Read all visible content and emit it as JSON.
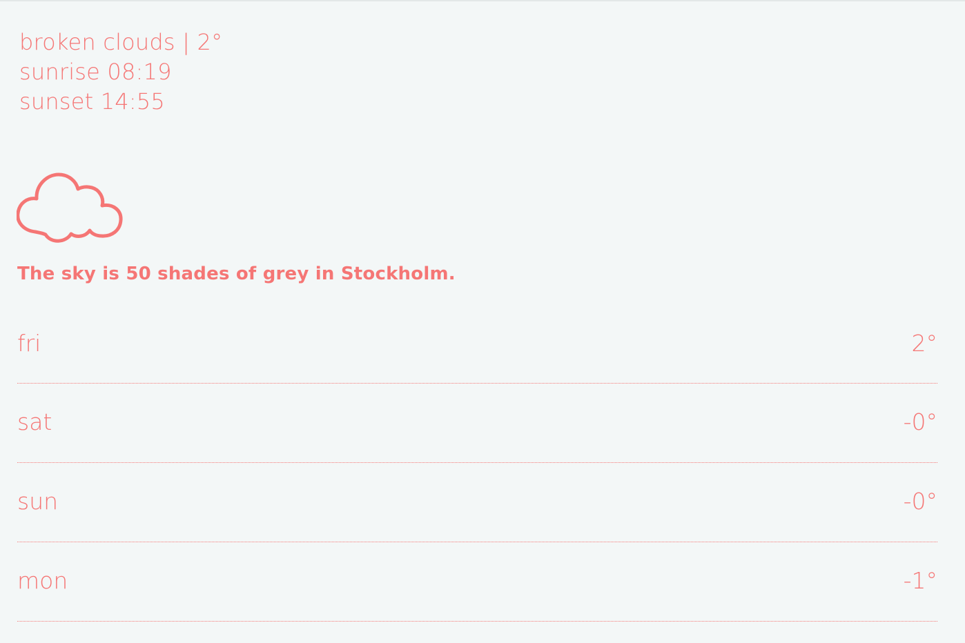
{
  "current": {
    "condition_line": "broken clouds | 2°",
    "sunrise_line": "sunrise 08:19",
    "sunset_line": "sunset 14:55"
  },
  "icon": "cloud-icon",
  "message": "The sky is 50 shades of grey in Stockholm.",
  "forecast": [
    {
      "day": "fri",
      "temp": "2°"
    },
    {
      "day": "sat",
      "temp": "-0°"
    },
    {
      "day": "sun",
      "temp": "-0°"
    },
    {
      "day": "mon",
      "temp": "-1°"
    }
  ],
  "colors": {
    "accent": "#f57675",
    "background": "#f3f7f7"
  }
}
